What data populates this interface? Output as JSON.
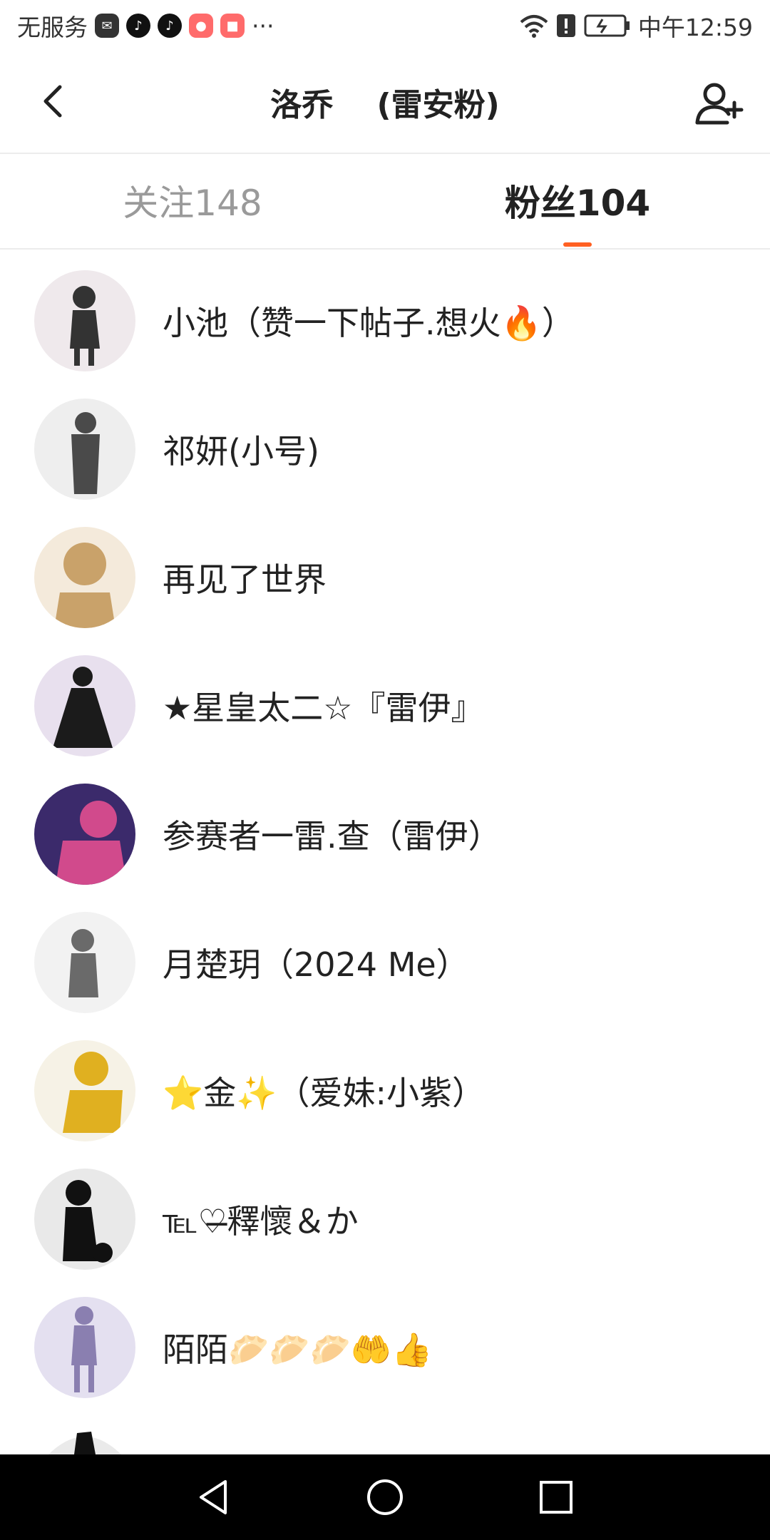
{
  "status_bar": {
    "carrier": "无服务",
    "dots": "···",
    "time": "中午12:59",
    "icons": [
      "mail-icon",
      "tiktok-icon",
      "tiktok-icon",
      "app-icon",
      "huawei-icon",
      "wifi-icon",
      "alert-icon",
      "battery-charging-icon"
    ]
  },
  "header": {
    "title": "洛乔    (雷安粉)",
    "back_icon": "chevron-left-icon",
    "add_icon": "add-user-icon"
  },
  "tabs": [
    {
      "label": "关注148",
      "active": false
    },
    {
      "label": "粉丝104",
      "active": true
    }
  ],
  "accent_color": "#ff6022",
  "users": [
    {
      "name": "小池（赞一下帖子.想火🔥）",
      "avatar_bg": "#efe9ec",
      "avatar_fg": "#333333"
    },
    {
      "name": "祁妍(小号)",
      "avatar_bg": "#eeeeee",
      "avatar_fg": "#4a4a4a"
    },
    {
      "name": "再见了世界",
      "avatar_bg": "#f4eadb",
      "avatar_fg": "#c9a26a"
    },
    {
      "name": "★星皇太二☆『雷伊』",
      "avatar_bg": "#e8e0ee",
      "avatar_fg": "#1b1b1b"
    },
    {
      "name": "参赛者一雷.查（雷伊）",
      "avatar_bg": "#3b2a6b",
      "avatar_fg": "#d14a8c"
    },
    {
      "name": "月楚玥（2024 Me）",
      "avatar_bg": "#f2f2f2",
      "avatar_fg": "#6a6a6a"
    },
    {
      "name": "⭐金✨（爱妹:小紫）",
      "avatar_bg": "#f6f2e6",
      "avatar_fg": "#e0b020"
    },
    {
      "name": "℡♡̶釋懷＆か",
      "avatar_bg": "#e9e9e9",
      "avatar_fg": "#111111"
    },
    {
      "name": "陌陌🥟🥟🥟🤲👍",
      "avatar_bg": "#e4e0f0",
      "avatar_fg": "#8a7fb0"
    }
  ],
  "system_nav": [
    "back-triangle-icon",
    "home-circle-icon",
    "recents-square-icon"
  ]
}
